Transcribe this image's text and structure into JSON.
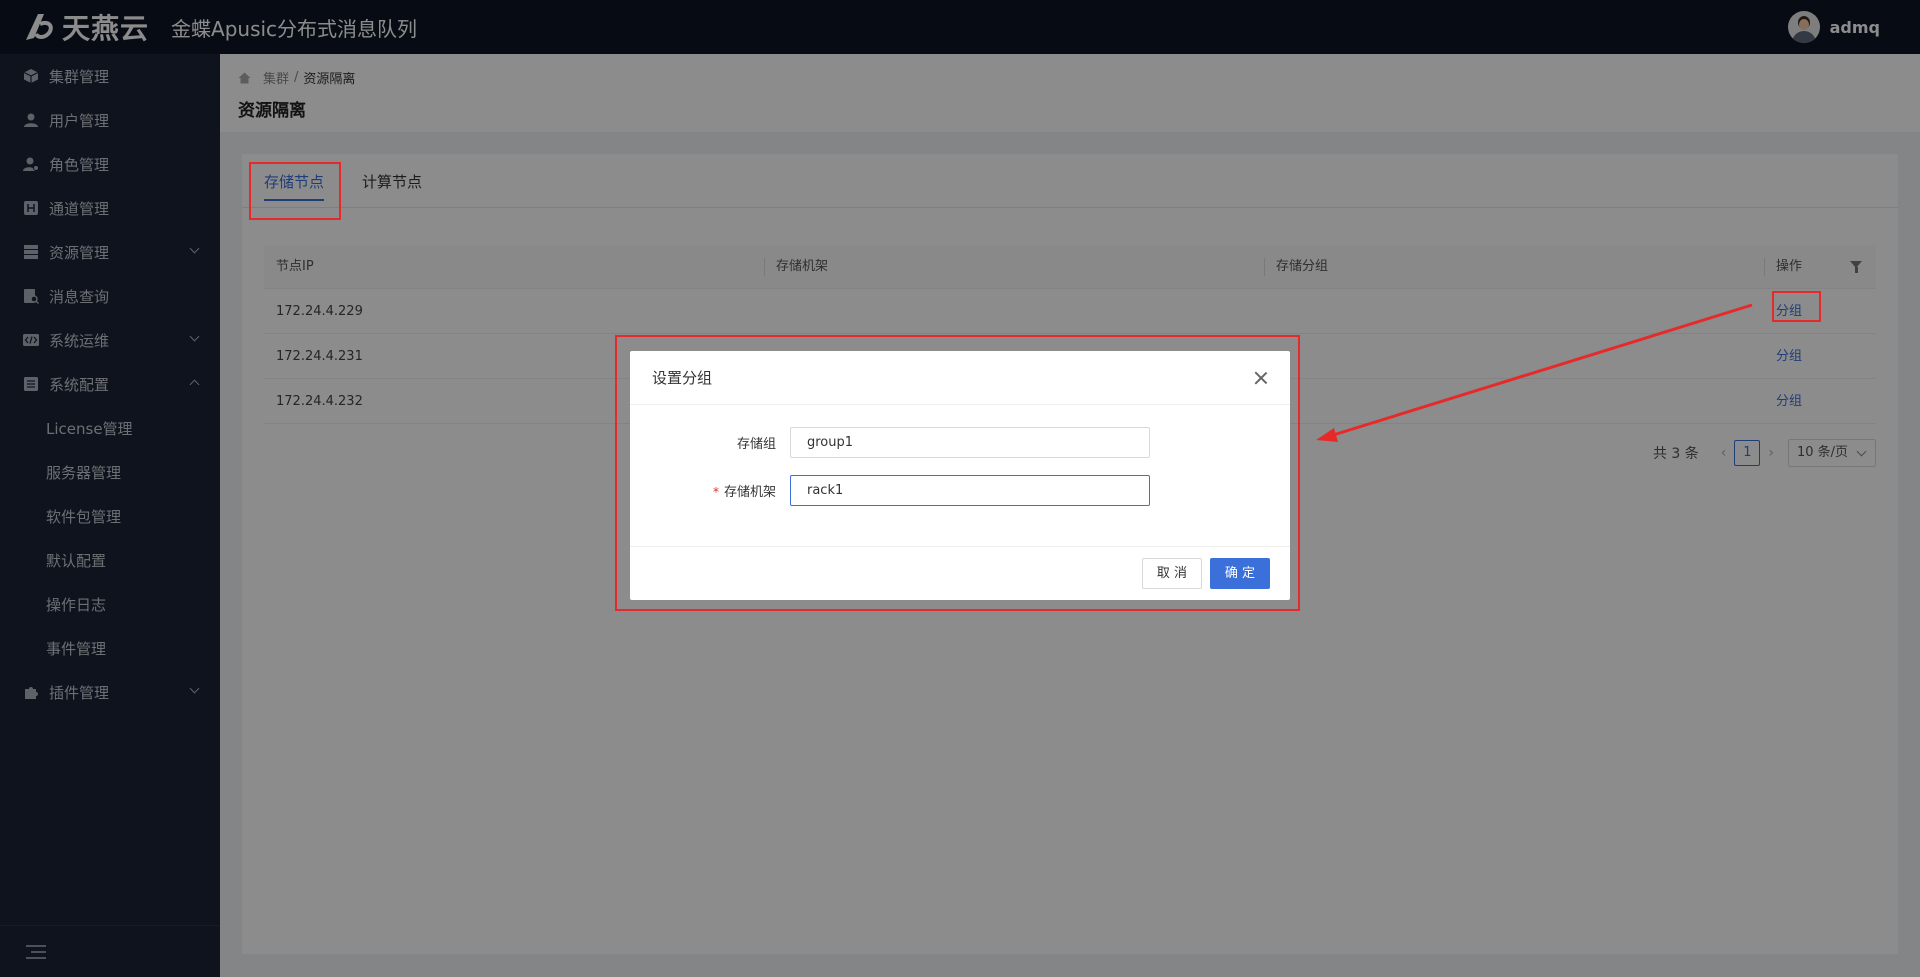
{
  "header": {
    "logo_text": "天燕云",
    "app_title": "金蝶Apusic分布式消息队列",
    "user_name": "admq"
  },
  "sidebar": {
    "items": [
      {
        "label": "集群管理",
        "icon": "cube-icon"
      },
      {
        "label": "用户管理",
        "icon": "user-icon"
      },
      {
        "label": "角色管理",
        "icon": "user-settings-icon"
      },
      {
        "label": "通道管理",
        "icon": "channel-icon"
      },
      {
        "label": "资源管理",
        "icon": "server-icon"
      },
      {
        "label": "消息查询",
        "icon": "message-search-icon"
      },
      {
        "label": "系统运维",
        "icon": "code-icon"
      },
      {
        "label": "系统配置",
        "icon": "list-icon"
      },
      {
        "label": "插件管理",
        "icon": "plugin-icon"
      }
    ],
    "sub_items": [
      "License管理",
      "服务器管理",
      "软件包管理",
      "默认配置",
      "操作日志",
      "事件管理"
    ]
  },
  "breadcrumb": {
    "root": "集群",
    "separator": "/",
    "current": "资源隔离"
  },
  "page_title": "资源隔离",
  "tabs": [
    "存储节点",
    "计算节点"
  ],
  "table": {
    "columns": [
      "节点IP",
      "存储机架",
      "存储分组",
      "操作"
    ],
    "rows": [
      {
        "ip": "172.24.4.229",
        "rack": "",
        "group": "",
        "action": "分组"
      },
      {
        "ip": "172.24.4.231",
        "rack": "",
        "group": "",
        "action": "分组"
      },
      {
        "ip": "172.24.4.232",
        "rack": "",
        "group": "",
        "action": "分组"
      }
    ]
  },
  "pagination": {
    "total": "共 3 条",
    "current_page": "1",
    "page_size": "10 条/页"
  },
  "modal": {
    "title": "设置分组",
    "fields": [
      {
        "label": "存储组",
        "value": "group1",
        "required": false
      },
      {
        "label": "存储机架",
        "value": "rack1",
        "required": true
      }
    ],
    "required_mark": "*",
    "cancel_label": "取 消",
    "ok_label": "确 定"
  },
  "colors": {
    "header_bg": "#0e1726",
    "sidebar_bg": "#1a2335",
    "accent": "#3b6fd9",
    "annotation": "#e62a2a"
  }
}
